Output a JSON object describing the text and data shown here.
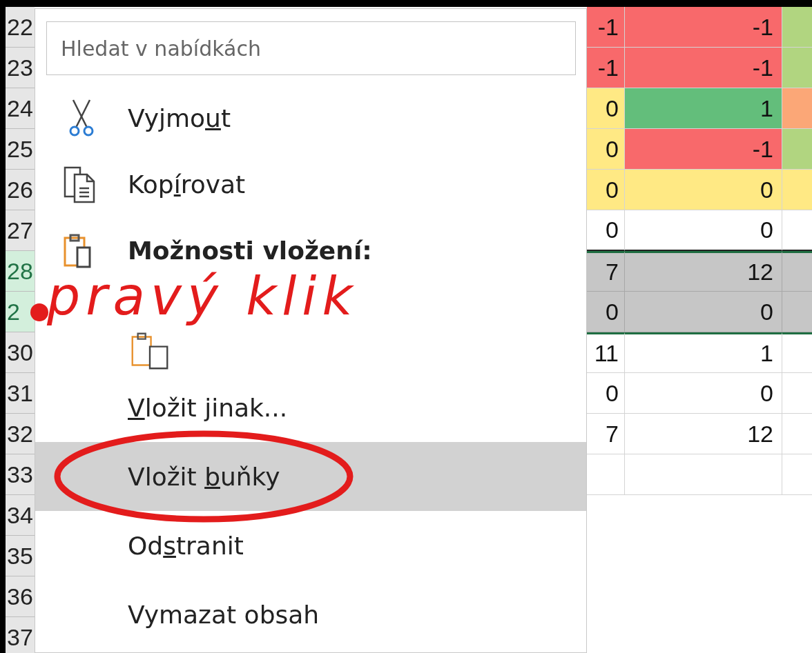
{
  "sheet": {
    "rows": [
      {
        "header": "22",
        "selected": false,
        "cells": [
          {
            "text": "-1",
            "color": "#f8696b"
          },
          {
            "text": "-1",
            "color": "#f8696b"
          },
          {
            "text": "",
            "color": "#b1d580"
          }
        ]
      },
      {
        "header": "23",
        "selected": false,
        "cells": [
          {
            "text": "-1",
            "color": "#f8696b"
          },
          {
            "text": "-1",
            "color": "#f8696b"
          },
          {
            "text": "",
            "color": "#b1d580"
          }
        ]
      },
      {
        "header": "24",
        "selected": false,
        "cells": [
          {
            "text": "0",
            "color": "#ffe984"
          },
          {
            "text": "1",
            "color": "#63be7b"
          },
          {
            "text": "",
            "color": "#fba777"
          }
        ]
      },
      {
        "header": "25",
        "selected": false,
        "cells": [
          {
            "text": "0",
            "color": "#ffe984"
          },
          {
            "text": "-1",
            "color": "#f8696b"
          },
          {
            "text": "",
            "color": "#b1d580"
          }
        ]
      },
      {
        "header": "26",
        "selected": false,
        "cells": [
          {
            "text": "0",
            "color": "#ffe984"
          },
          {
            "text": "0",
            "color": "#ffe984"
          },
          {
            "text": "",
            "color": "#ffe984"
          }
        ]
      },
      {
        "header": "27",
        "selected": false,
        "cells": [
          {
            "text": "0",
            "color": "#ffffff"
          },
          {
            "text": "0",
            "color": "#ffffff"
          },
          {
            "text": "",
            "color": "#ffffff"
          }
        ]
      },
      {
        "header": "28",
        "selected": true,
        "cells": [
          {
            "text": "7",
            "color": "#c6c6c6"
          },
          {
            "text": "12",
            "color": "#c6c6c6"
          },
          {
            "text": "",
            "color": "#c6c6c6"
          }
        ]
      },
      {
        "header": "2",
        "selected": true,
        "cells": [
          {
            "text": "0",
            "color": "#c6c6c6"
          },
          {
            "text": "0",
            "color": "#c6c6c6"
          },
          {
            "text": "",
            "color": "#c6c6c6"
          }
        ]
      },
      {
        "header": "30",
        "selected": false,
        "cells": [
          {
            "text": "11",
            "color": "#ffffff"
          },
          {
            "text": "1",
            "color": "#ffffff"
          },
          {
            "text": "",
            "color": "#ffffff"
          }
        ]
      },
      {
        "header": "31",
        "selected": false,
        "cells": [
          {
            "text": "0",
            "color": "#ffffff"
          },
          {
            "text": "0",
            "color": "#ffffff"
          },
          {
            "text": "",
            "color": "#ffffff"
          }
        ]
      },
      {
        "header": "32",
        "selected": false,
        "cells": [
          {
            "text": "7",
            "color": "#ffffff"
          },
          {
            "text": "12",
            "color": "#ffffff"
          },
          {
            "text": "",
            "color": "#ffffff"
          }
        ]
      },
      {
        "header": "33",
        "selected": false,
        "cells": [
          {
            "text": "",
            "color": "#ffffff"
          },
          {
            "text": "",
            "color": "#ffffff"
          },
          {
            "text": "",
            "color": "#ffffff"
          }
        ]
      },
      {
        "header": "34",
        "selected": false
      },
      {
        "header": "35",
        "selected": false
      },
      {
        "header": "36",
        "selected": false
      },
      {
        "header": "37",
        "selected": false
      }
    ]
  },
  "context_menu": {
    "search": {
      "placeholder": "Hledat v nabídkách"
    },
    "items": [
      {
        "kind": "command",
        "label": {
          "before": "Vyjmo",
          "accel": "u",
          "after": "t"
        },
        "selected": false
      },
      {
        "kind": "command",
        "label": {
          "before": "Kop",
          "accel": "í",
          "after": "rovat"
        },
        "selected": false
      },
      {
        "kind": "heading",
        "label": {
          "before": "Možnosti vložení:"
        }
      },
      {
        "kind": "paste_options"
      },
      {
        "kind": "command",
        "label": {
          "accel": "V",
          "after": "ložit jinak..."
        },
        "selected": false
      },
      {
        "kind": "command",
        "label": {
          "before": "Vložit ",
          "accel": "b",
          "after": "uňky"
        },
        "selected": true
      },
      {
        "kind": "command",
        "label": {
          "before": "Od",
          "accel": "s",
          "after": "tranit"
        },
        "selected": false
      },
      {
        "kind": "command",
        "label": {
          "before": "Vymazat obsah"
        },
        "selected": false
      }
    ]
  },
  "annotations": [
    {
      "kind": "handwriting",
      "text": "pravý klik"
    },
    {
      "kind": "ellipse"
    }
  ]
}
